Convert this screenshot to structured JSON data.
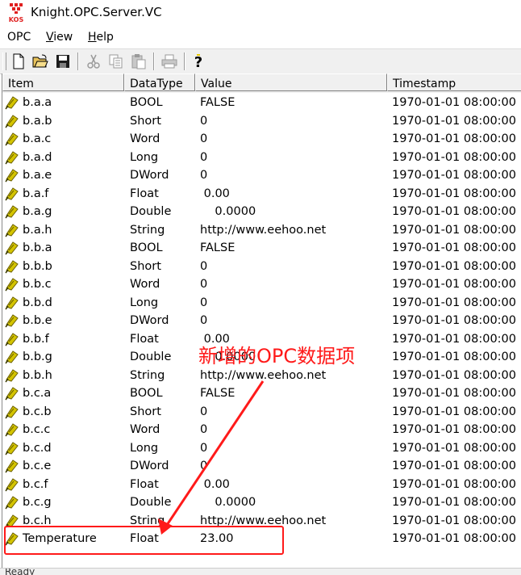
{
  "window": {
    "title": "Knight.OPC.Server.VC",
    "logo_text": "KOS"
  },
  "menu": [
    {
      "label": "OPC"
    },
    {
      "label": "View",
      "accel": "V",
      "rest": "iew"
    },
    {
      "label": "Help",
      "accel": "H",
      "rest": "elp"
    }
  ],
  "toolbar": {
    "buttons": [
      "new-file-icon",
      "open-folder-icon",
      "save-icon",
      "cut-icon",
      "copy-icon",
      "paste-icon",
      "print-icon",
      "help-icon"
    ]
  },
  "columns": [
    "Item",
    "DataType",
    "Value",
    "Timestamp"
  ],
  "rows": [
    {
      "item": "b.a.a",
      "type": "BOOL",
      "value": "FALSE",
      "timestamp": "1970-01-01 08:00:00"
    },
    {
      "item": "b.a.b",
      "type": "Short",
      "value": "0",
      "timestamp": "1970-01-01 08:00:00"
    },
    {
      "item": "b.a.c",
      "type": "Word",
      "value": "0",
      "timestamp": "1970-01-01 08:00:00"
    },
    {
      "item": "b.a.d",
      "type": "Long",
      "value": "0",
      "timestamp": "1970-01-01 08:00:00"
    },
    {
      "item": "b.a.e",
      "type": "DWord",
      "value": "0",
      "timestamp": "1970-01-01 08:00:00"
    },
    {
      "item": "b.a.f",
      "type": "Float",
      "value": " 0.00",
      "timestamp": "1970-01-01 08:00:00"
    },
    {
      "item": "b.a.g",
      "type": "Double",
      "value": "    0.0000",
      "timestamp": "1970-01-01 08:00:00"
    },
    {
      "item": "b.a.h",
      "type": "String",
      "value": "http://www.eehoo.net",
      "timestamp": "1970-01-01 08:00:00"
    },
    {
      "item": "b.b.a",
      "type": "BOOL",
      "value": "FALSE",
      "timestamp": "1970-01-01 08:00:00"
    },
    {
      "item": "b.b.b",
      "type": "Short",
      "value": "0",
      "timestamp": "1970-01-01 08:00:00"
    },
    {
      "item": "b.b.c",
      "type": "Word",
      "value": "0",
      "timestamp": "1970-01-01 08:00:00"
    },
    {
      "item": "b.b.d",
      "type": "Long",
      "value": "0",
      "timestamp": "1970-01-01 08:00:00"
    },
    {
      "item": "b.b.e",
      "type": "DWord",
      "value": "0",
      "timestamp": "1970-01-01 08:00:00"
    },
    {
      "item": "b.b.f",
      "type": "Float",
      "value": " 0.00",
      "timestamp": "1970-01-01 08:00:00"
    },
    {
      "item": "b.b.g",
      "type": "Double",
      "value": "    0.0000",
      "timestamp": "1970-01-01 08:00:00"
    },
    {
      "item": "b.b.h",
      "type": "String",
      "value": "http://www.eehoo.net",
      "timestamp": "1970-01-01 08:00:00"
    },
    {
      "item": "b.c.a",
      "type": "BOOL",
      "value": "FALSE",
      "timestamp": "1970-01-01 08:00:00"
    },
    {
      "item": "b.c.b",
      "type": "Short",
      "value": "0",
      "timestamp": "1970-01-01 08:00:00"
    },
    {
      "item": "b.c.c",
      "type": "Word",
      "value": "0",
      "timestamp": "1970-01-01 08:00:00"
    },
    {
      "item": "b.c.d",
      "type": "Long",
      "value": "0",
      "timestamp": "1970-01-01 08:00:00"
    },
    {
      "item": "b.c.e",
      "type": "DWord",
      "value": "0",
      "timestamp": "1970-01-01 08:00:00"
    },
    {
      "item": "b.c.f",
      "type": "Float",
      "value": " 0.00",
      "timestamp": "1970-01-01 08:00:00"
    },
    {
      "item": "b.c.g",
      "type": "Double",
      "value": "    0.0000",
      "timestamp": "1970-01-01 08:00:00"
    },
    {
      "item": "b.c.h",
      "type": "String",
      "value": "http://www.eehoo.net",
      "timestamp": "1970-01-01 08:00:00"
    },
    {
      "item": "Temperature",
      "type": "Float",
      "value": "23.00",
      "timestamp": "1970-01-01 08:00:00"
    }
  ],
  "annotation": {
    "text": "新增的OPC数据项",
    "color": "#ff1a1a"
  },
  "statusbar": {
    "text": "Ready"
  },
  "colors": {
    "tag_icon": "#d4c400",
    "annotation": "#ff1a1a",
    "toolbar_bg": "#f0f0f0"
  }
}
